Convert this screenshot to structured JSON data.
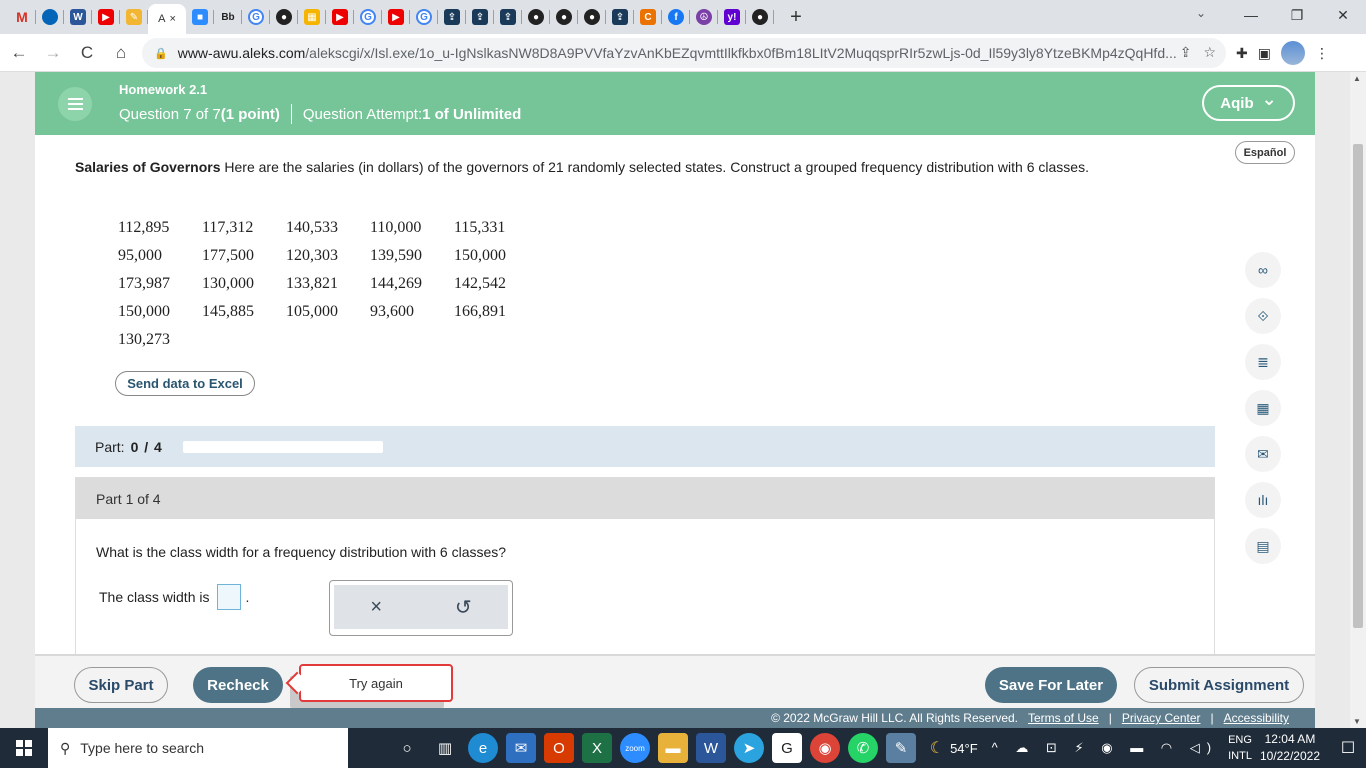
{
  "browser": {
    "tab_labels": [
      "M",
      "W",
      "Bb",
      "A"
    ],
    "tab_close": "×",
    "new_tab": "+",
    "back": "←",
    "forward": "→",
    "reload": "C",
    "home": "⌂",
    "url_host": "www-awu.aleks.com",
    "url_path": "/alekscgi/x/Isl.exe/1o_u-IgNslkasNW8D8A9PVVfaYzvAnKbEZqvmttIlkfkbx0fBm18LItV2MuqqsprRIr5zwLjs-0d_Il59y3ly8YtzeBKMp4zQqHfd...",
    "window_controls": [
      "—",
      "❐",
      "✕"
    ]
  },
  "header": {
    "homework_title": "Homework 2.1",
    "question_prefix": "Question 7 of 7 ",
    "question_points": "(1 point)",
    "attempt_prefix": "Question Attempt: ",
    "attempt_value": "1 of Unlimited",
    "user_name": "Aqib",
    "user_chevron": "⌄"
  },
  "espanol_label": "Español",
  "problem": {
    "title": "Salaries of Governors",
    "text": " Here are the salaries (in dollars) of the governors of 21 randomly selected states. Construct a grouped frequency distribution with 6 classes."
  },
  "salaries": [
    [
      "112,895",
      "117,312",
      "140,533",
      "110,000",
      "115,331"
    ],
    [
      "95,000",
      "177,500",
      "120,303",
      "139,590",
      "150,000"
    ],
    [
      "173,987",
      "130,000",
      "133,821",
      "144,269",
      "142,542"
    ],
    [
      "150,000",
      "145,885",
      "105,000",
      "93,600",
      "166,891"
    ],
    [
      "130,273"
    ]
  ],
  "excel_button": "Send data to Excel",
  "side_tools": [
    "∞",
    "⟐",
    "≣",
    "▦",
    "✉",
    "ılı",
    "▤"
  ],
  "part_status": {
    "label": "Part:",
    "value": "0 / 4",
    "progress": 0
  },
  "part": {
    "heading": "Part 1 of 4",
    "question": "What is the class width for a frequency distribution with 6 classes?",
    "answer_label": "The class width is",
    "answer_value": "",
    "answer_suffix": ".",
    "clear_symbol": "×",
    "undo_symbol": "↺"
  },
  "footer": {
    "skip": "Skip Part",
    "recheck": "Recheck",
    "try_again": "Try again",
    "save": "Save For Later",
    "submit": "Submit Assignment"
  },
  "copyright": {
    "text": "© 2022 McGraw Hill LLC. All Rights Reserved.",
    "terms": "Terms of Use",
    "privacy": "Privacy Center",
    "accessibility": "Accessibility",
    "separator": "|"
  },
  "taskbar": {
    "search_placeholder": "Type here to search",
    "search_icon": "⚲",
    "weather": "54°F",
    "tray_icons": "^ ☁ ⊡ ⚡ ◉ ▬ ◠ ◁)",
    "lang_top": "ENG",
    "lang_bottom": "INTL",
    "time": "12:04 AM",
    "date": "10/22/2022",
    "notification_icon": "☐"
  },
  "colors": {
    "header_green": "#76c598",
    "primary_button": "#4e7286",
    "error_red": "#e23a3a"
  }
}
